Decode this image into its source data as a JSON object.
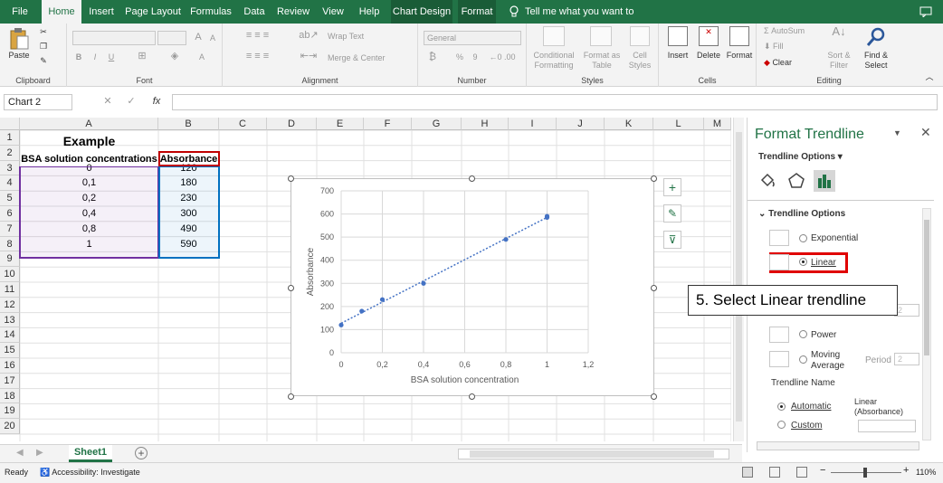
{
  "tabs": {
    "file": "File",
    "home": "Home",
    "insert": "Insert",
    "page_layout": "Page Layout",
    "formulas": "Formulas",
    "data": "Data",
    "review": "Review",
    "view": "View",
    "help": "Help",
    "chart_design": "Chart Design",
    "format": "Format",
    "tell_me": "Tell me what you want to do"
  },
  "ribbon": {
    "clipboard": {
      "paste": "Paste",
      "label": "Clipboard"
    },
    "font": {
      "label": "Font",
      "bold": "B",
      "italic": "I",
      "underline": "U",
      "grow": "A",
      "shrink": "A",
      "color": "A"
    },
    "alignment": {
      "wrap_text": "Wrap Text",
      "merge_center": "Merge & Center",
      "label": "Alignment"
    },
    "number": {
      "format": "General",
      "percent": "%",
      "comma": "9",
      "label": "Number"
    },
    "styles": {
      "conditional1": "Conditional",
      "conditional2": "Formatting",
      "format_table1": "Format as",
      "format_table2": "Table",
      "cell_styles1": "Cell",
      "cell_styles2": "Styles",
      "label": "Styles"
    },
    "cells": {
      "insert": "Insert",
      "delete": "Delete",
      "format": "Format",
      "label": "Cells"
    },
    "editing": {
      "autosum": "AutoSum",
      "fill": "Fill",
      "clear": "Clear",
      "sort1": "Sort &",
      "sort2": "Filter",
      "find1": "Find &",
      "find2": "Select",
      "label": "Editing"
    }
  },
  "formula_bar": {
    "name_box": "Chart 2",
    "fx": "fx",
    "cancel": "✕",
    "enter": "✓",
    "value": ""
  },
  "grid": {
    "columns": [
      "A",
      "B",
      "C",
      "D",
      "E",
      "F",
      "G",
      "H",
      "I",
      "J",
      "K",
      "L",
      "M"
    ],
    "rows": [
      "1",
      "2",
      "3",
      "4",
      "5",
      "6",
      "7",
      "8",
      "9",
      "10",
      "11",
      "12",
      "13",
      "14",
      "15",
      "16",
      "17",
      "18",
      "19",
      "20"
    ],
    "title": "Example",
    "header_a": "BSA solution concentrations",
    "header_b": "Absorbance",
    "col_a": [
      "0",
      "0,1",
      "0,2",
      "0,4",
      "0,8",
      "1"
    ],
    "col_b": [
      "120",
      "180",
      "230",
      "300",
      "490",
      "590"
    ]
  },
  "chart_data": {
    "type": "scatter",
    "x": [
      0,
      0.1,
      0.2,
      0.4,
      0.8,
      1,
      1
    ],
    "y": [
      120,
      180,
      230,
      300,
      490,
      590,
      585
    ],
    "trendline": "linear",
    "xlabel": "BSA solution concentration",
    "ylabel": "Absorbance",
    "xlim": [
      0,
      1.2
    ],
    "ylim": [
      0,
      700
    ],
    "xticks": [
      "0",
      "0,2",
      "0,4",
      "0,6",
      "0,8",
      "1",
      "1,2"
    ],
    "yticks": [
      "0",
      "100",
      "200",
      "300",
      "400",
      "500",
      "600",
      "700"
    ],
    "grid": true,
    "colors": {
      "point": "#4472c4",
      "trend": "#4472c4"
    }
  },
  "chart_buttons": {
    "add": "+",
    "brush": "✎",
    "filter": "⊽"
  },
  "pane": {
    "title": "Format Trendline",
    "options_tab": "Trendline Options",
    "section": "Trendline Options",
    "exponential": "Exponential",
    "linear": "Linear",
    "power": "Power",
    "moving_average1": "Moving",
    "moving_average2": "Average",
    "period": "Period",
    "period_value": "2",
    "order_value": "2",
    "name_label": "Trendline Name",
    "automatic": "Automatic",
    "auto_value1": "Linear",
    "auto_value2": "(Absorbance)",
    "custom": "Custom"
  },
  "callout": "5. Select Linear trendline",
  "sheet_tab": "Sheet1",
  "status": {
    "ready": "Ready",
    "accessibility": "Accessibility: Investigate",
    "zoom": "110%"
  },
  "colors": {
    "accent": "#217346",
    "highlight": "#e00000",
    "col_a_border": "#7030a0",
    "col_b_border": "#0070c0",
    "header_b_border": "#c00000"
  }
}
